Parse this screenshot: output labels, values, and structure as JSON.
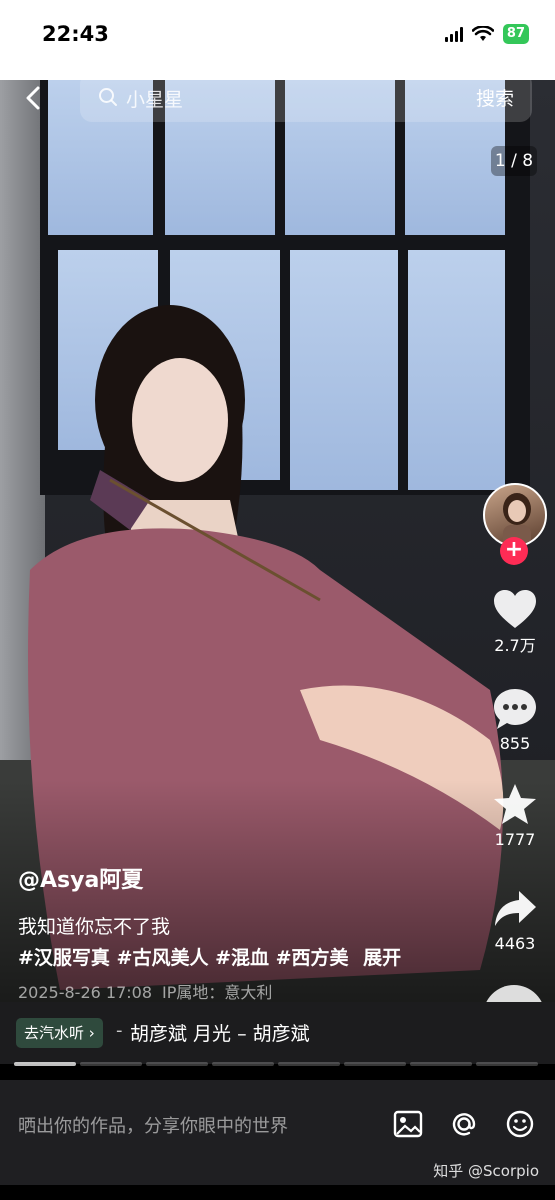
{
  "status_bar": {
    "time": "22:43",
    "battery": "87"
  },
  "search": {
    "query": "小星星",
    "button": "搜索"
  },
  "photo": {
    "counter": "1 / 8"
  },
  "actions": {
    "likes": "2.7万",
    "comments": "855",
    "favorites": "1777",
    "shares": "4463"
  },
  "post": {
    "author": "@Asya阿夏",
    "caption": "我知道你忘不了我",
    "tags": "#汉服写真 #古风美人 #混血 #西方美",
    "expand": "展开",
    "date": "2025-8-26 17:08",
    "ip": "IP属地：意大利"
  },
  "music": {
    "chip_label": "去汽水听 ›",
    "dash": "-",
    "song": "胡彦斌    月光 – 胡彦斌"
  },
  "composer": {
    "placeholder": "晒出你的作品，分享你眼中的世界"
  },
  "watermark": "知乎 @Scorpio",
  "colors": {
    "accent_red": "#fe2c55",
    "battery_green": "#34c759"
  },
  "icons": [
    "back-icon",
    "search-icon",
    "heart-icon",
    "comment-icon",
    "star-icon",
    "share-icon",
    "mute-icon",
    "image-icon",
    "at-icon",
    "emoji-icon"
  ]
}
